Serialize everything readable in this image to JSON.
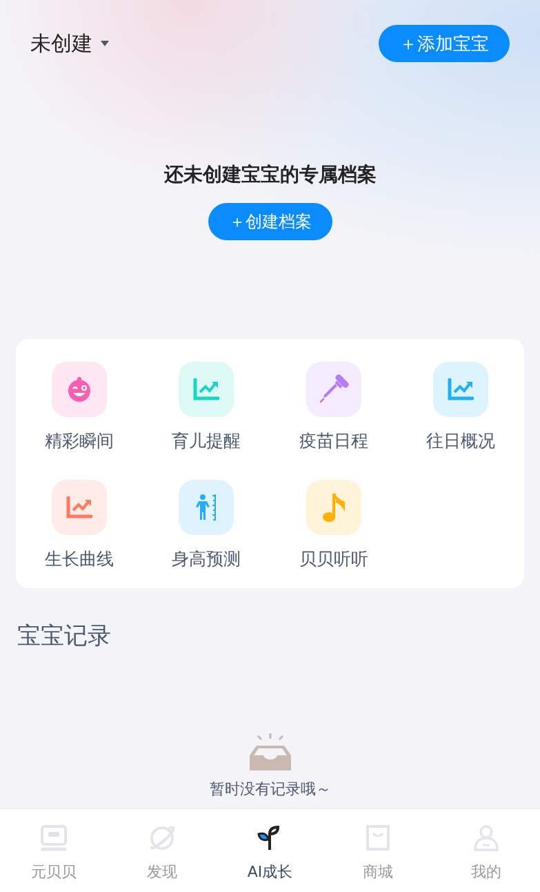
{
  "header": {
    "baby_selector": "未创建",
    "add_button": "＋添加宝宝"
  },
  "empty_profile": {
    "message": "还未创建宝宝的专属档案",
    "create_button": "＋创建档案"
  },
  "features": [
    {
      "label": "精彩瞬间",
      "kind": "face",
      "color": "#f85fb0"
    },
    {
      "label": "育儿提醒",
      "kind": "chart",
      "color": "#19d6c4"
    },
    {
      "label": "疫苗日程",
      "kind": "dropper",
      "color": "#b57cf5"
    },
    {
      "label": "往日概况",
      "kind": "chart",
      "color": "#1fb0f5"
    },
    {
      "label": "生长曲线",
      "kind": "chart",
      "color": "#ff7a5c"
    },
    {
      "label": "身高预测",
      "kind": "height",
      "color": "#26aef5"
    },
    {
      "label": "贝贝听听",
      "kind": "note",
      "color": "#ffb000"
    }
  ],
  "records": {
    "title": "宝宝记录",
    "empty_text": "暂时没有记录哦～"
  },
  "tab_bar": [
    {
      "label": "元贝贝",
      "kind": "device",
      "selected": false
    },
    {
      "label": "发现",
      "kind": "planet",
      "selected": false
    },
    {
      "label": "AI成长",
      "kind": "sprout",
      "selected": true
    },
    {
      "label": "商城",
      "kind": "bag",
      "selected": false
    },
    {
      "label": "我的",
      "kind": "person",
      "selected": false
    }
  ]
}
